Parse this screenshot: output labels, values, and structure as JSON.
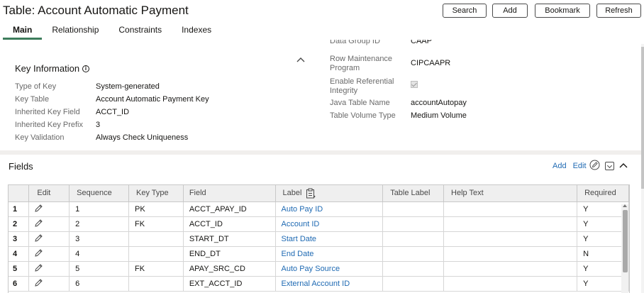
{
  "header": {
    "title": "Table: Account Automatic Payment",
    "buttons": {
      "search": "Search",
      "add": "Add",
      "bookmark": "Bookmark",
      "refresh": "Refresh"
    },
    "tabs": [
      "Main",
      "Relationship",
      "Constraints",
      "Indexes"
    ]
  },
  "key_info": {
    "title": "Key Information",
    "rows": [
      {
        "label": "Type of Key",
        "value": "System-generated"
      },
      {
        "label": "Key Table",
        "value": "Account Automatic Payment Key"
      },
      {
        "label": "Inherited Key Field",
        "value": "ACCT_ID"
      },
      {
        "label": "Inherited Key Prefix",
        "value": "3"
      },
      {
        "label": "Key Validation",
        "value": "Always Check Uniqueness"
      }
    ]
  },
  "table_info": {
    "partial_label": "Data Group ID",
    "partial_value": "CAAP",
    "row_maintenance_label": "Row Maintenance Program",
    "row_maintenance_value": "CIPCAAPR",
    "referential_label": "Enable Referential Integrity",
    "java_label": "Java Table Name",
    "java_value": "accountAutopay",
    "volume_label": "Table Volume Type",
    "volume_value": "Medium Volume"
  },
  "fields": {
    "title": "Fields",
    "add_label": "Add",
    "edit_label": "Edit",
    "columns": [
      "Edit",
      "Sequence",
      "Key Type",
      "Field",
      "Label",
      "Table Label",
      "Help Text",
      "Required"
    ],
    "rows": [
      {
        "num": "1",
        "seq": "1",
        "key": "PK",
        "field": "ACCT_APAY_ID",
        "label": "Auto Pay ID",
        "req": "Y"
      },
      {
        "num": "2",
        "seq": "2",
        "key": "FK",
        "field": "ACCT_ID",
        "label": "Account ID",
        "req": "Y"
      },
      {
        "num": "3",
        "seq": "3",
        "key": "",
        "field": "START_DT",
        "label": "Start Date",
        "req": "Y"
      },
      {
        "num": "4",
        "seq": "4",
        "key": "",
        "field": "END_DT",
        "label": "End Date",
        "req": "N"
      },
      {
        "num": "5",
        "seq": "5",
        "key": "FK",
        "field": "APAY_SRC_CD",
        "label": "Auto Pay Source",
        "req": "Y"
      },
      {
        "num": "6",
        "seq": "6",
        "key": "",
        "field": "EXT_ACCT_ID",
        "label": "External Account ID",
        "req": "Y"
      }
    ]
  },
  "colors": {
    "link": "#1f6ab3",
    "tab_accent": "#3e7d5c",
    "label_gray": "#6a6a6a"
  }
}
